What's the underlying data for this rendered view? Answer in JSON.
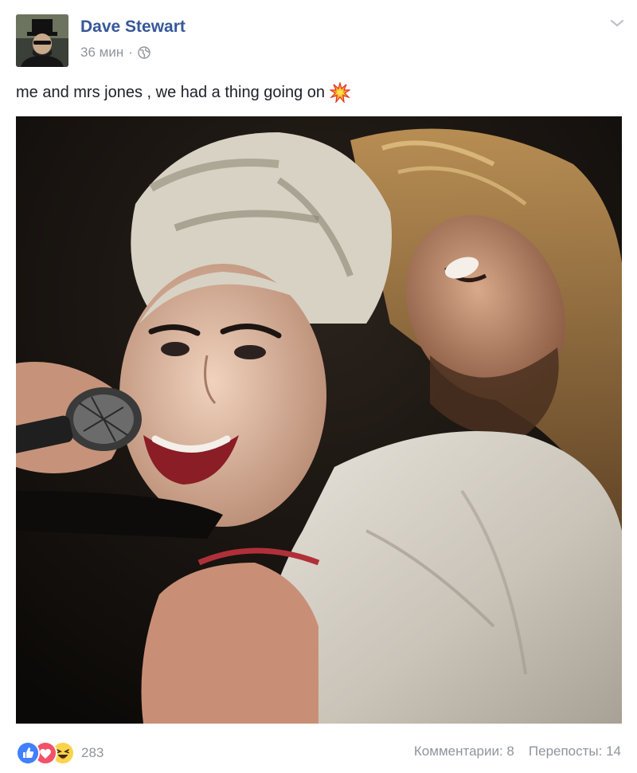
{
  "post": {
    "author": "Dave Stewart",
    "time": "36 мин",
    "separator": "·",
    "audience_icon": "globe-icon",
    "menu_icon": "chevron-down-icon",
    "caption": "me and mrs jones , we had a thing going on",
    "caption_emoji": "collision-emoji",
    "photo": {
      "description_icon": "concert-photo"
    }
  },
  "footer": {
    "reactions": [
      "like-reaction-icon",
      "love-reaction-icon",
      "haha-reaction-icon"
    ],
    "reaction_count": "283",
    "comments": "Комментарии: 8",
    "shares": "Перепосты: 14"
  },
  "colors": {
    "author": "#365899",
    "secondary_text": "#90949c",
    "like": "#4080ff",
    "love": "#f25268",
    "haha": "#fcd34a"
  }
}
